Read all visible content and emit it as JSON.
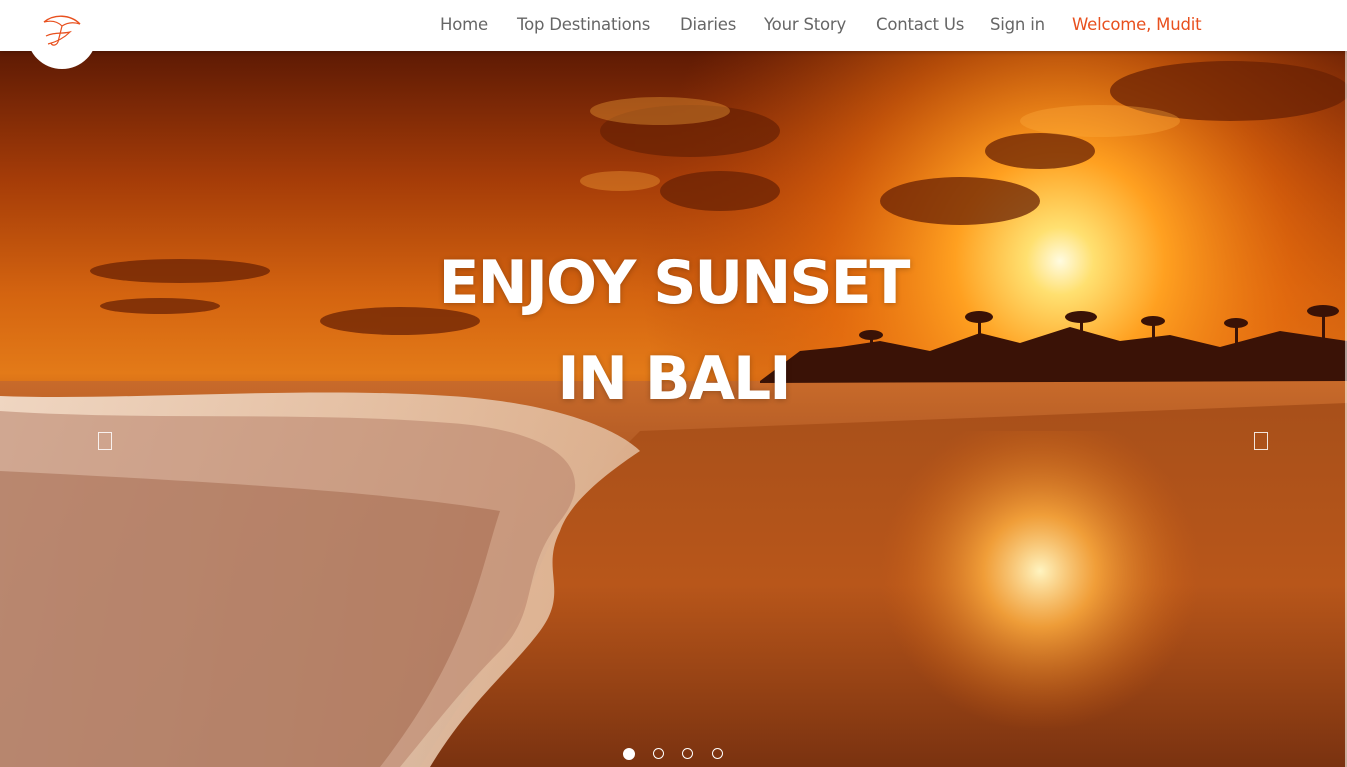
{
  "header": {
    "logo_icon": "umbrella-bird-logo-icon",
    "nav": [
      {
        "label": "Home",
        "key": "home"
      },
      {
        "label": "Top Destinations",
        "key": "top-destinations"
      },
      {
        "label": "Diaries",
        "key": "diaries"
      },
      {
        "label": "Your Story",
        "key": "your-story"
      },
      {
        "label": "Contact Us",
        "key": "contact-us"
      },
      {
        "label": "Sign in",
        "key": "sign-in"
      }
    ],
    "welcome": "Welcome, Mudit"
  },
  "hero": {
    "headline_line1": "ENJOY SUNSET",
    "headline_line2": "IN BALI",
    "prev_icon": "chevron-left-icon",
    "next_icon": "chevron-right-icon",
    "slides_count": 4,
    "active_slide": 1
  },
  "colors": {
    "accent": "#e8501e",
    "nav_text": "#666666",
    "headline": "#ffffff"
  }
}
